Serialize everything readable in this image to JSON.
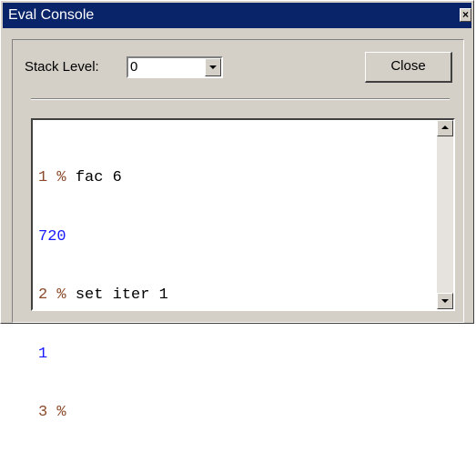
{
  "window": {
    "title": "Eval Console",
    "close_glyph": "×"
  },
  "controls": {
    "stack_level_label": "Stack Level:",
    "stack_level_value": "0",
    "close_button_label": "Close"
  },
  "console": {
    "lines": [
      {
        "prompt": "1 %",
        "command": "fac 6"
      },
      {
        "result": "720"
      },
      {
        "prompt": "2 %",
        "command": "set iter 1"
      },
      {
        "result": "1"
      },
      {
        "prompt": "3 %",
        "command": ""
      }
    ]
  },
  "icons": {
    "titlebar_close": "close-icon",
    "dropdown": "chevron-down-icon",
    "scroll_up": "arrow-up-icon",
    "scroll_down": "arrow-down-icon"
  },
  "colors": {
    "titlebar": "#0a246a",
    "face": "#d4d0c8",
    "prompt": "#8b4a2a",
    "result": "#1a1aff"
  }
}
